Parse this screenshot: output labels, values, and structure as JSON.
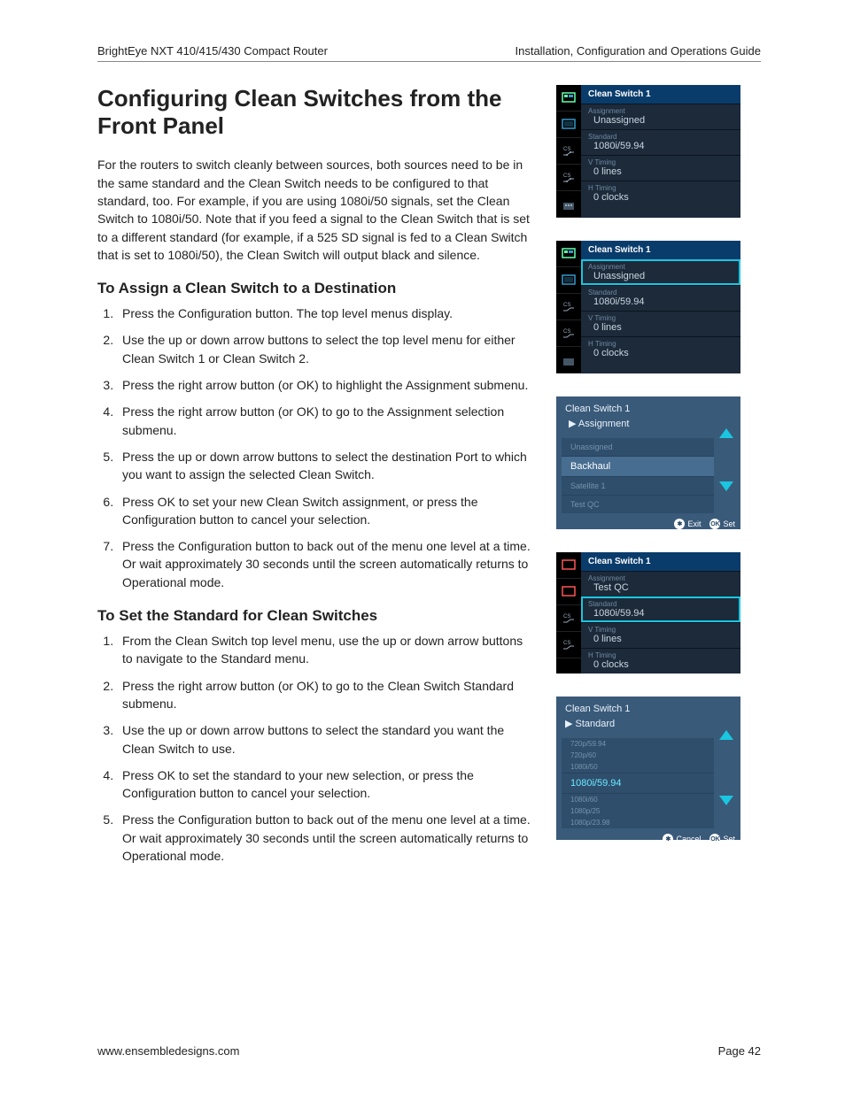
{
  "header": {
    "left": "BrightEye NXT 410/415/430 Compact Router",
    "right": "Installation, Configuration and Operations Guide"
  },
  "title": "Configuring Clean Switches from the Front Panel",
  "intro": "For the routers to switch cleanly between sources, both sources need to be in the same standard and the Clean Switch needs to be configured to that standard, too.  For example, if you are using 1080i/50 signals, set the Clean Switch to 1080i/50. Note that if you feed a signal to the Clean Switch that is set to a different standard (for example, if a 525 SD signal is fed to a Clean Switch that is set to 1080i/50), the Clean Switch will output black and silence.",
  "section_a": {
    "heading": "To Assign a Clean Switch to a Destination",
    "steps": [
      "Press the Configuration button. The top level menus display.",
      "Use the up or down arrow buttons to select the top level menu for either Clean Switch 1 or Clean Switch 2.",
      "Press the right arrow button (or OK) to highlight the Assignment submenu.",
      "Press the right arrow button (or OK) to go to the Assignment selection submenu.",
      "Press the up or down arrow buttons to select the destination Port to which you want to assign the selected Clean Switch.",
      "Press OK to set your new Clean Switch assignment, or press the Configuration button to cancel your selection.",
      "Press the Configuration button to back out of the menu one level at a time. Or wait approximately 30 seconds until the screen automatically returns to Operational mode."
    ]
  },
  "section_b": {
    "heading": "To Set the Standard for Clean Switches",
    "steps": [
      "From the Clean Switch top level menu, use the up or down arrow buttons to navigate to the Standard menu.",
      "Press the right arrow button (or OK) to go to the Clean Switch Standard submenu.",
      "Use the up or down arrow buttons to select the standard you want the Clean Switch to use.",
      "Press OK to set the standard to your new selection, or press the Configuration button to cancel your selection.",
      "Press the Configuration button to back out of the menu one level at a time. Or wait approximately 30 seconds until the screen automatically returns to Operational mode."
    ]
  },
  "panels": {
    "p1": {
      "title": "Clean Switch 1",
      "rows": [
        {
          "label": "Assignment",
          "value": "Unassigned"
        },
        {
          "label": "Standard",
          "value": "1080i/59.94"
        },
        {
          "label": "V Timing",
          "value": "0 lines"
        },
        {
          "label": "H Timing",
          "value": "0 clocks"
        }
      ]
    },
    "p2": {
      "title": "Clean Switch 1",
      "rows": [
        {
          "label": "Assignment",
          "value": "Unassigned",
          "selected": true
        },
        {
          "label": "Standard",
          "value": "1080i/59.94"
        },
        {
          "label": "V Timing",
          "value": "0 lines"
        },
        {
          "label": "H Timing",
          "value": "0 clocks"
        }
      ]
    },
    "p3": {
      "crumb1": "Clean Switch 1",
      "crumb2": "▶ Assignment",
      "options": [
        {
          "text": "Unassigned",
          "dim": true
        },
        {
          "text": "Backhaul",
          "hi": true
        },
        {
          "text": "Satellite 1",
          "dim": true
        },
        {
          "text": "Test QC",
          "dim": true
        }
      ],
      "btn_left": "Exit",
      "btn_right": "Set",
      "gear": "✱",
      "ok": "OK"
    },
    "p4": {
      "title": "Clean Switch 1",
      "rows": [
        {
          "label": "Assignment",
          "value": "Test QC"
        },
        {
          "label": "Standard",
          "value": "1080i/59.94",
          "selected": true
        },
        {
          "label": "V Timing",
          "value": "0 lines"
        },
        {
          "label": "H Timing",
          "value": "0 clocks"
        }
      ]
    },
    "p5": {
      "crumb1": "Clean Switch 1",
      "crumb2": "▶ Standard",
      "options": [
        {
          "text": "720p/59.94",
          "dim": true
        },
        {
          "text": "720p/60",
          "dim": true
        },
        {
          "text": "1080i/50",
          "dim": true
        },
        {
          "text": "1080i/59.94",
          "sel": true
        },
        {
          "text": "1080i/60",
          "dim": true
        },
        {
          "text": "1080p/25",
          "dim": true
        },
        {
          "text": "1080p/23.98",
          "dim": true
        }
      ],
      "btn_left": "Cancel",
      "btn_right": "Set",
      "gear": "✱",
      "ok": "OK"
    }
  },
  "footer": {
    "left": "www.ensembledesigns.com",
    "right": "Page 42"
  }
}
